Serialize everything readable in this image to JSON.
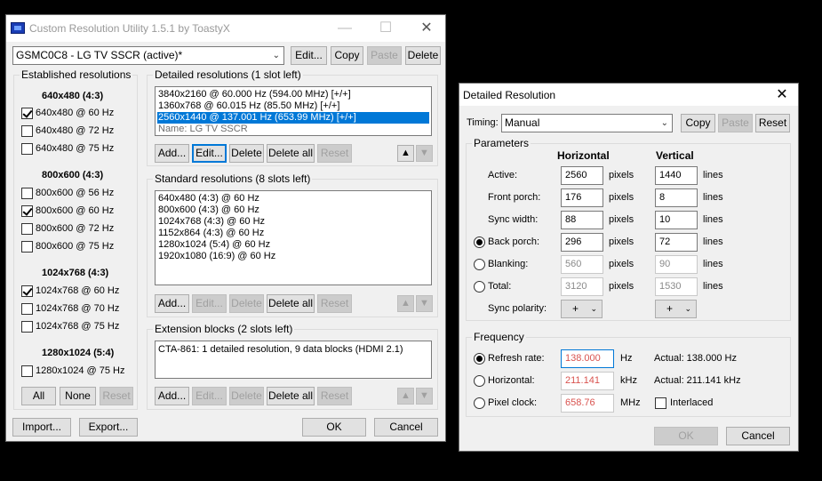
{
  "main": {
    "title": "Custom Resolution Utility 1.5.1 by ToastyX",
    "monitor_combo": "GSMC0C8 - LG TV SSCR (active)*",
    "top_buttons": {
      "edit": "Edit...",
      "copy": "Copy",
      "paste": "Paste",
      "delete": "Delete"
    },
    "established": {
      "label": "Established resolutions",
      "groups": [
        {
          "header": "640x480 (4:3)",
          "items": [
            {
              "label": "640x480 @ 60 Hz",
              "checked": true
            },
            {
              "label": "640x480 @ 72 Hz",
              "checked": false
            },
            {
              "label": "640x480 @ 75 Hz",
              "checked": false
            }
          ]
        },
        {
          "header": "800x600 (4:3)",
          "items": [
            {
              "label": "800x600 @ 56 Hz",
              "checked": false
            },
            {
              "label": "800x600 @ 60 Hz",
              "checked": true
            },
            {
              "label": "800x600 @ 72 Hz",
              "checked": false
            },
            {
              "label": "800x600 @ 75 Hz",
              "checked": false
            }
          ]
        },
        {
          "header": "1024x768 (4:3)",
          "items": [
            {
              "label": "1024x768 @ 60 Hz",
              "checked": true
            },
            {
              "label": "1024x768 @ 70 Hz",
              "checked": false
            },
            {
              "label": "1024x768 @ 75 Hz",
              "checked": false
            }
          ]
        },
        {
          "header": "1280x1024 (5:4)",
          "items": [
            {
              "label": "1280x1024 @ 75 Hz",
              "checked": false
            }
          ]
        }
      ],
      "buttons": {
        "all": "All",
        "none": "None",
        "reset": "Reset"
      }
    },
    "detailed": {
      "label": "Detailed resolutions (1 slot left)",
      "items": [
        "3840x2160 @ 60.000 Hz (594.00 MHz) [+/+]",
        "1360x768 @ 60.015 Hz (85.50 MHz) [+/+]",
        "2560x1440 @ 137.001 Hz (653.99 MHz) [+/+]"
      ],
      "name_line": "Name: LG TV SSCR",
      "buttons": {
        "add": "Add...",
        "edit": "Edit...",
        "delete": "Delete",
        "delete_all": "Delete all",
        "reset": "Reset"
      }
    },
    "standard": {
      "label": "Standard resolutions (8 slots left)",
      "items": [
        "640x480 (4:3) @ 60 Hz",
        "800x600 (4:3) @ 60 Hz",
        "1024x768 (4:3) @ 60 Hz",
        "1152x864 (4:3) @ 60 Hz",
        "1280x1024 (5:4) @ 60 Hz",
        "1920x1080 (16:9) @ 60 Hz"
      ],
      "buttons": {
        "add": "Add...",
        "edit": "Edit...",
        "delete": "Delete",
        "delete_all": "Delete all",
        "reset": "Reset"
      }
    },
    "extension": {
      "label": "Extension blocks (2 slots left)",
      "items": [
        "CTA-861: 1 detailed resolution, 9 data blocks (HDMI 2.1)"
      ],
      "buttons": {
        "add": "Add...",
        "edit": "Edit...",
        "delete": "Delete",
        "delete_all": "Delete all",
        "reset": "Reset"
      }
    },
    "bottom": {
      "import": "Import...",
      "export": "Export...",
      "ok": "OK",
      "cancel": "Cancel"
    }
  },
  "dialog": {
    "title": "Detailed Resolution",
    "timing_label": "Timing:",
    "timing_value": "Manual",
    "timing_buttons": {
      "copy": "Copy",
      "paste": "Paste",
      "reset": "Reset"
    },
    "parameters_label": "Parameters",
    "col_horizontal": "Horizontal",
    "col_vertical": "Vertical",
    "rows": [
      {
        "label": "Active:",
        "h": "2560",
        "v": "1440",
        "radio": false,
        "ro": false
      },
      {
        "label": "Front porch:",
        "h": "176",
        "v": "8",
        "radio": false,
        "ro": false
      },
      {
        "label": "Sync width:",
        "h": "88",
        "v": "10",
        "radio": false,
        "ro": false
      },
      {
        "label": "Back porch:",
        "h": "296",
        "v": "72",
        "radio": true,
        "selected": true,
        "ro": false
      },
      {
        "label": "Blanking:",
        "h": "560",
        "v": "90",
        "radio": true,
        "selected": false,
        "ro": true
      },
      {
        "label": "Total:",
        "h": "3120",
        "v": "1530",
        "radio": true,
        "selected": false,
        "ro": true
      }
    ],
    "unit_pixels": "pixels",
    "unit_lines": "lines",
    "sync_polarity_label": "Sync polarity:",
    "sync_h": "+",
    "sync_v": "+",
    "frequency_label": "Frequency",
    "freq_rows": [
      {
        "label": "Refresh rate:",
        "value": "138.000",
        "unit": "Hz",
        "actual": "Actual: 138.000 Hz",
        "selected": true
      },
      {
        "label": "Horizontal:",
        "value": "211.141",
        "unit": "kHz",
        "actual": "Actual: 211.141 kHz",
        "selected": false
      },
      {
        "label": "Pixel clock:",
        "value": "658.76",
        "unit": "MHz",
        "actual": "",
        "selected": false
      }
    ],
    "interlaced_label": "Interlaced",
    "ok": "OK",
    "cancel": "Cancel"
  }
}
